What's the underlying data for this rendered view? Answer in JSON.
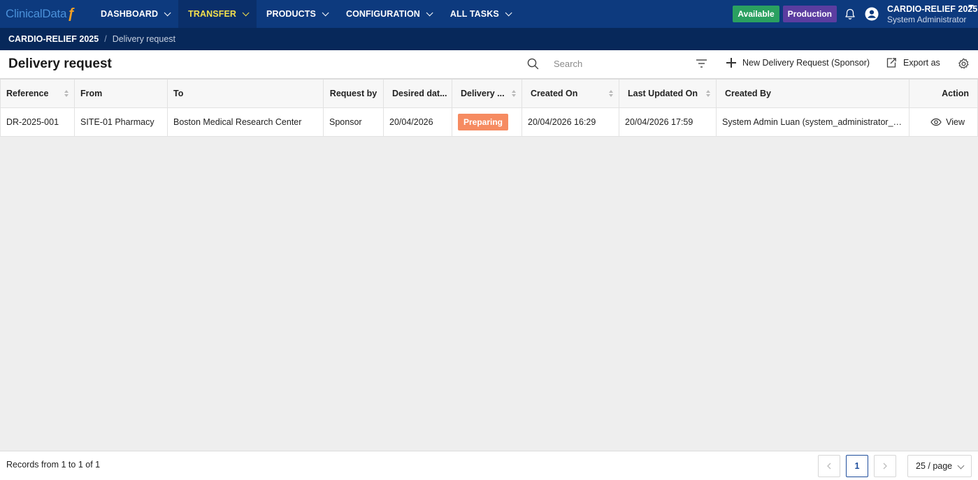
{
  "brand": {
    "logo_text": "ClinicalData",
    "logo_mark": "ƒ"
  },
  "nav": {
    "items": [
      {
        "label": "DASHBOARD"
      },
      {
        "label": "TRANSFER"
      },
      {
        "label": "PRODUCTS"
      },
      {
        "label": "CONFIGURATION"
      },
      {
        "label": "ALL TASKS"
      }
    ],
    "active": "TRANSFER"
  },
  "status": {
    "available": "Available",
    "environment": "Production"
  },
  "user": {
    "project": "CARDIO-RELIEF 2025",
    "role": "System Administrator"
  },
  "breadcrumb": {
    "root": "CARDIO-RELIEF 2025",
    "separator": "/",
    "current": "Delivery request"
  },
  "toolbar": {
    "title": "Delivery request",
    "search_placeholder": "Search",
    "new_label": "New Delivery Request (Sponsor)",
    "export_label": "Export as"
  },
  "table": {
    "headers": {
      "reference": "Reference",
      "from": "From",
      "to": "To",
      "request_by": "Request by",
      "desired_date": "Desired dat...",
      "delivery_status": "Delivery ...",
      "created_on": "Created On",
      "last_updated_on": "Last Updated On",
      "created_by": "Created By",
      "action": "Action"
    },
    "rows": [
      {
        "reference": "DR-2025-001",
        "from": "SITE-01 Pharmacy",
        "to": "Boston Medical Research Center",
        "request_by": "Sponsor",
        "desired_date": "20/04/2026",
        "status": "Preparing",
        "created_on": "20/04/2026 16:29",
        "last_updated_on": "20/04/2026 17:59",
        "created_by": "System Admin Luan (system_administrator_lu...",
        "action": "View"
      }
    ]
  },
  "footer": {
    "records": "Records from 1 to 1 of 1",
    "current_page": "1",
    "page_size": "25 / page"
  },
  "colors": {
    "nav_bg": "#0d3a7e",
    "nav_active_text": "#f4e04d",
    "available": "#2aa060",
    "production": "#5b3da0",
    "status_preparing": "#f68b61",
    "page_accent": "#1f4e9c"
  }
}
